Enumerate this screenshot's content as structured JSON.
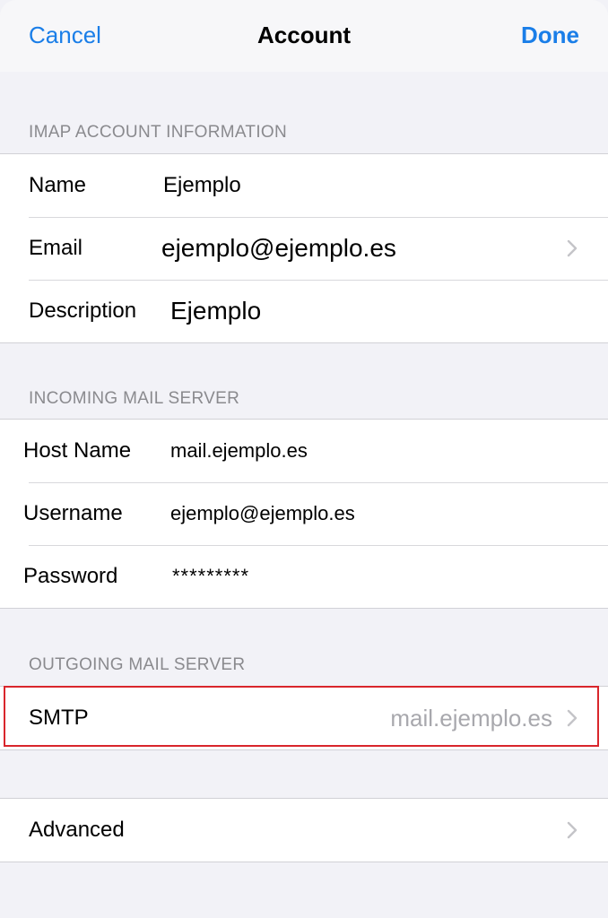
{
  "nav": {
    "cancel": "Cancel",
    "title": "Account",
    "done": "Done"
  },
  "sections": {
    "imap_header": "IMAP ACCOUNT INFORMATION",
    "incoming_header": "INCOMING MAIL SERVER",
    "outgoing_header": "OUTGOING MAIL SERVER"
  },
  "imap": {
    "name_label": "Name",
    "name_value": "Ejemplo",
    "email_label": "Email",
    "email_value": "ejemplo@ejemplo.es",
    "description_label": "Description",
    "description_value": "Ejemplo"
  },
  "incoming": {
    "host_label": "Host Name",
    "host_value": "mail.ejemplo.es",
    "username_label": "Username",
    "username_value": "ejemplo@ejemplo.es",
    "password_label": "Password",
    "password_value": "*********"
  },
  "outgoing": {
    "smtp_label": "SMTP",
    "smtp_value": "mail.ejemplo.es"
  },
  "advanced": {
    "label": "Advanced"
  },
  "colors": {
    "accent": "#1a7ee8",
    "highlight": "#d9262c",
    "background": "#f2f2f7"
  },
  "icons": {
    "chevron": "chevron-right-icon"
  }
}
